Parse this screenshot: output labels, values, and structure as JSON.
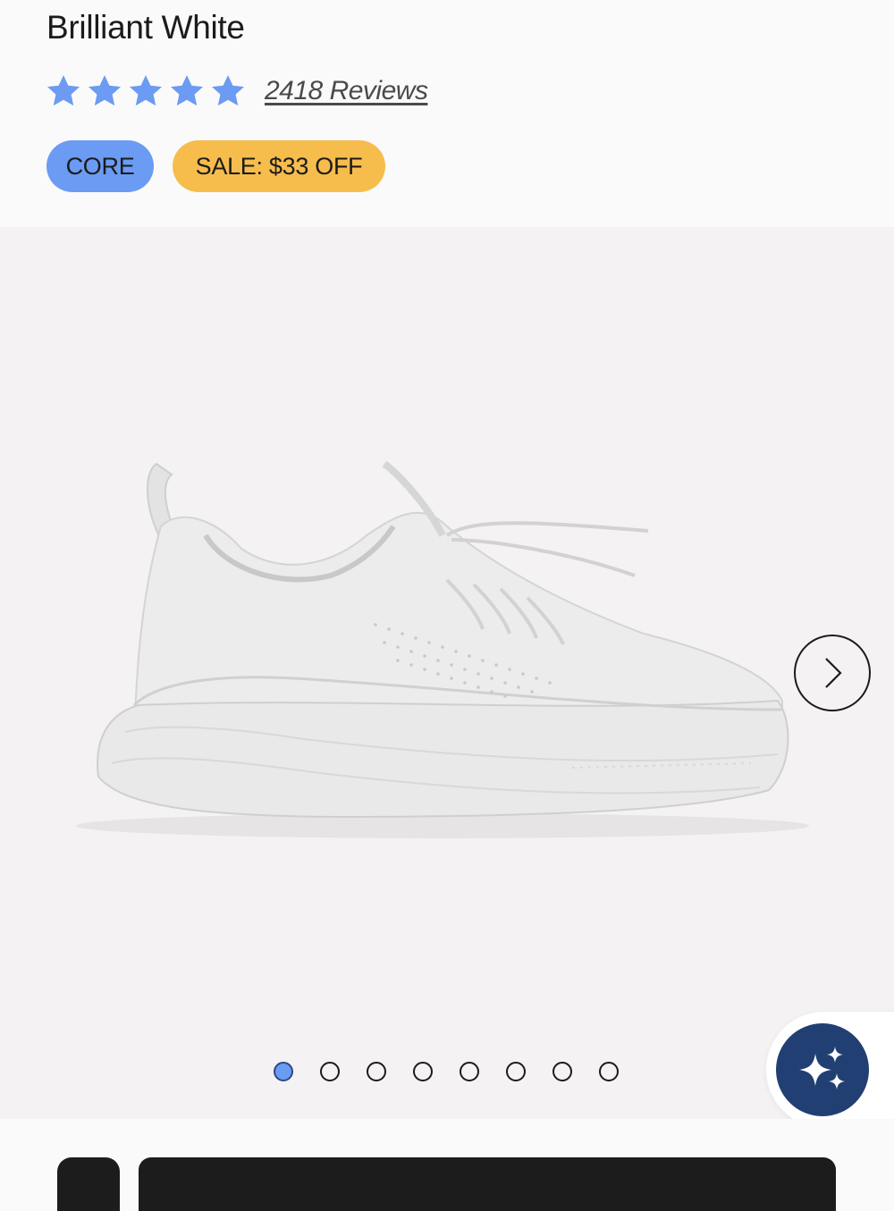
{
  "product": {
    "color_name": "Brilliant White",
    "rating_stars": 5,
    "reviews_label": "2418 Reviews"
  },
  "badges": {
    "core": "CORE",
    "sale": "SALE: $33 OFF"
  },
  "gallery": {
    "total_images": 8,
    "active_index": 0
  },
  "colors": {
    "star": "#6b9bf2",
    "core_badge": "#6b9bf2",
    "sale_badge": "#f6bd4d",
    "ai_button": "#213f72",
    "gallery_bg": "#f4f2f2"
  },
  "icons": {
    "next": "chevron-right-icon",
    "ai": "sparkles-icon"
  }
}
